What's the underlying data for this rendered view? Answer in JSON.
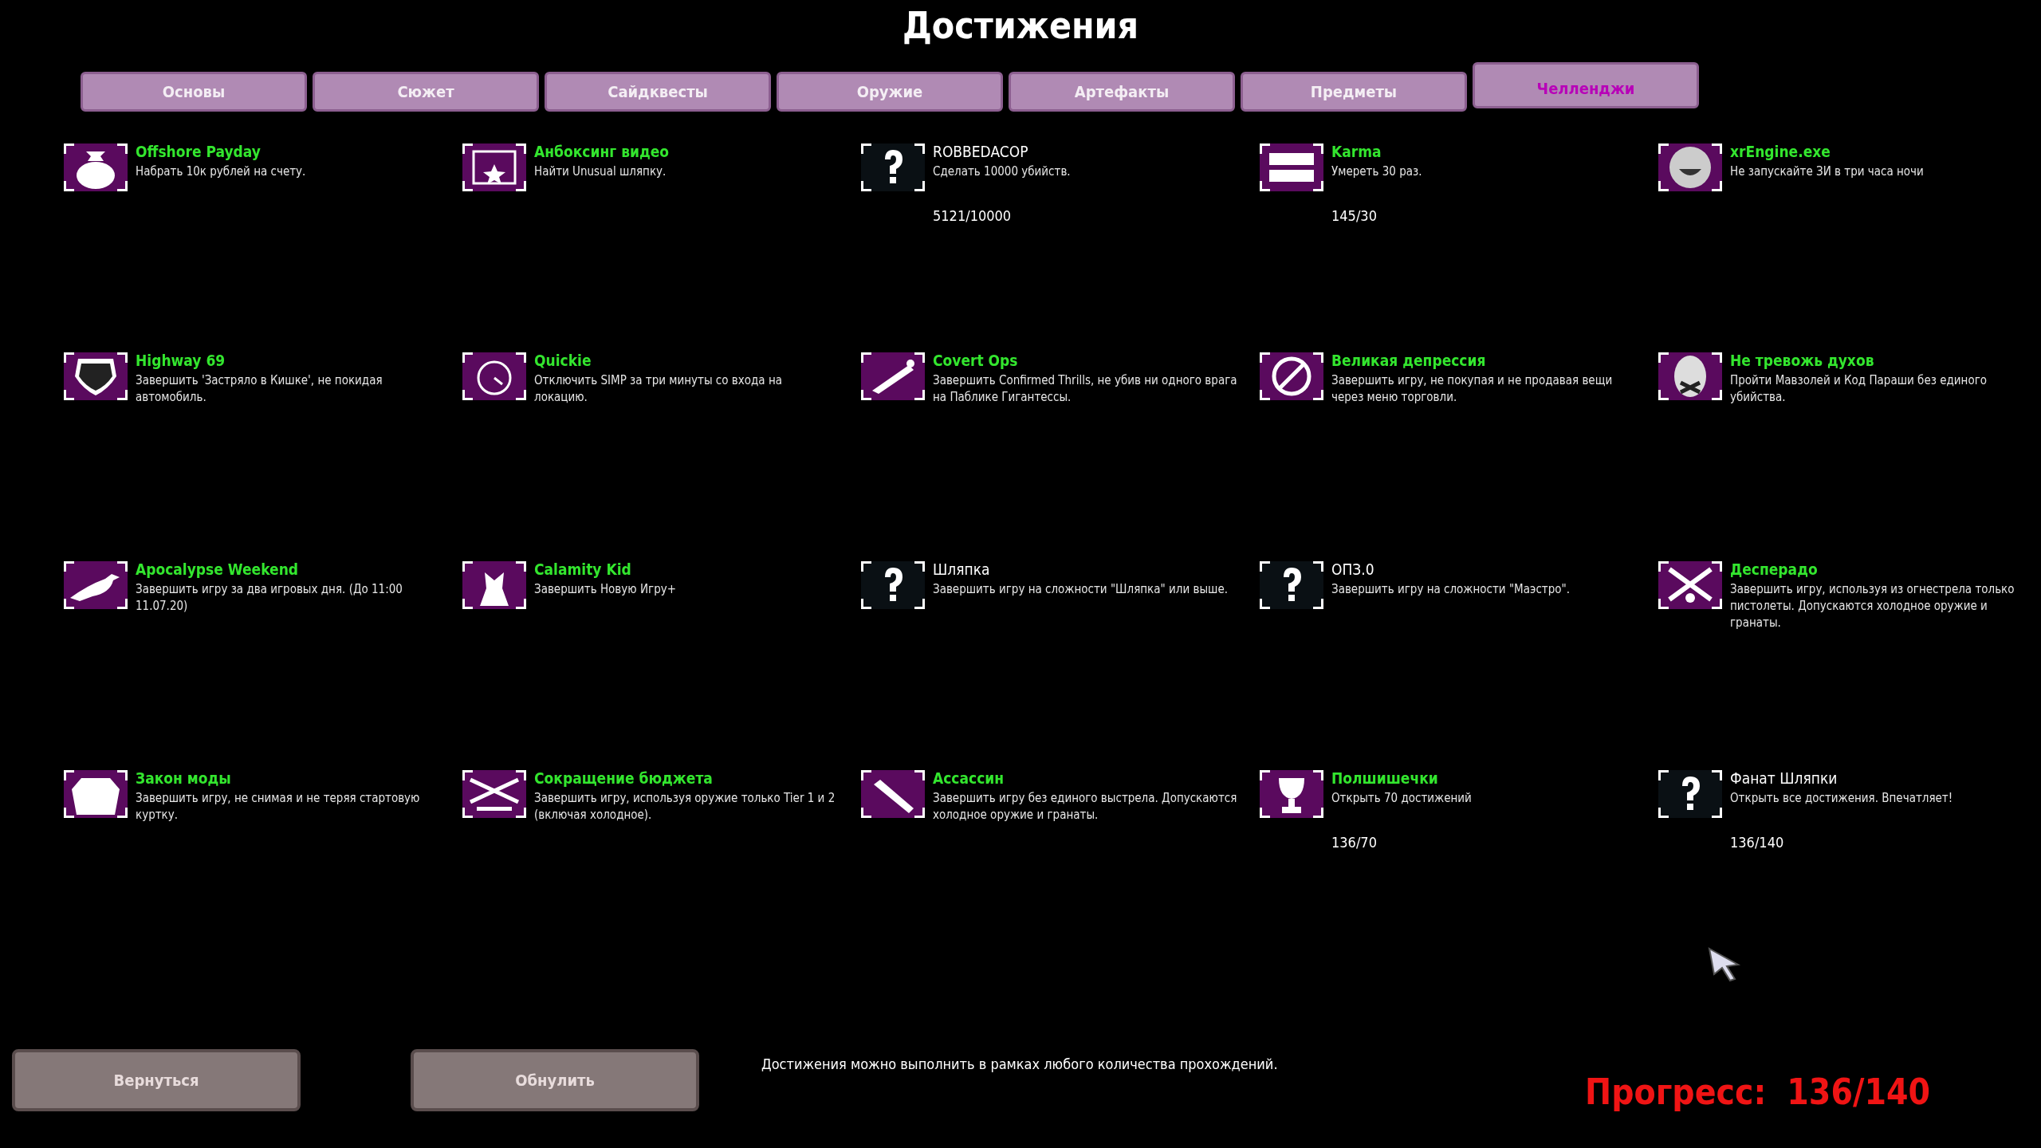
{
  "title": "Достижения",
  "tabs": [
    {
      "label": "Основы",
      "selected": false
    },
    {
      "label": "Сюжет",
      "selected": false
    },
    {
      "label": "Сайдквесты",
      "selected": false
    },
    {
      "label": "Оружие",
      "selected": false
    },
    {
      "label": "Артефакты",
      "selected": false
    },
    {
      "label": "Предметы",
      "selected": false
    },
    {
      "label": "Челленджи",
      "selected": true
    }
  ],
  "achievements": [
    {
      "title": "Offshore Payday",
      "description": "Набрать 10к рублей на счету.",
      "unlocked": true
    },
    {
      "title": "Анбоксинг видео",
      "description": "Найти Unusual шляпку.",
      "unlocked": true
    },
    {
      "title": "ROBBEDACOP",
      "description": "Сделать 10000 убийств.",
      "unlocked": false,
      "progress": "5121/10000"
    },
    {
      "title": "Karma",
      "description": "Умереть 30 раз.",
      "unlocked": true,
      "progress": "145/30"
    },
    {
      "title": "xrEngine.exe",
      "description": "Не запускайте ЗИ в три часа ночи",
      "unlocked": true
    },
    {
      "title": "Highway 69",
      "description": "Завершить 'Застряло в Кишке', не покидая автомобиль.",
      "unlocked": true
    },
    {
      "title": "Quickie",
      "description": "Отключить SIMP за три минуты со входа на локацию.",
      "unlocked": true
    },
    {
      "title": "Covert Ops",
      "description": "Завершить Confirmed Thrills, не убив ни одного врага на Паблике Гигантессы.",
      "unlocked": true
    },
    {
      "title": "Великая депрессия",
      "description": "Завершить игру, не покупая и не продавая вещи через меню торговли.",
      "unlocked": true
    },
    {
      "title": "Не тревожь духов",
      "description": "Пройти Мавзолей и Код Параши без единого убийства.",
      "unlocked": true
    },
    {
      "title": "Apocalypse Weekend",
      "description": "Завершить игру за два игровых дня. (До 11:00 11.07.20)",
      "unlocked": true
    },
    {
      "title": "Calamity Kid",
      "description": "Завершить Новую Игру+",
      "unlocked": true
    },
    {
      "title": "Шляпка",
      "description": "Завершить игру на сложности \"Шляпка\" или выше.",
      "unlocked": false
    },
    {
      "title": "ОПЗ.0",
      "description": "Завершить игру на сложности \"Маэстро\".",
      "unlocked": false
    },
    {
      "title": "Десперадо",
      "description": "Завершить игру, используя из огнестрела только пистолеты. Допускаются холодное оружие и гранаты.",
      "unlocked": true
    },
    {
      "title": "Закон моды",
      "description": "Завершить игру, не снимая и не теряя стартовую куртку.",
      "unlocked": true
    },
    {
      "title": "Сокращение бюджета",
      "description": "Завершить игру, используя оружие только Tier 1 и 2 (включая холодное).",
      "unlocked": true
    },
    {
      "title": "Ассассин",
      "description": "Завершить игру без единого выстрела. Допускаются холодное оружие и гранаты.",
      "unlocked": true
    },
    {
      "title": "Полшишечки",
      "description": "Открыть 70 достижений",
      "unlocked": true,
      "progress": "136/70"
    },
    {
      "title": "Фанат Шляпки",
      "description": "Открыть все достижения. Впечатляет!",
      "unlocked": false,
      "progress": "136/140"
    }
  ],
  "buttons": [
    "Вернуться",
    "Обнулить"
  ],
  "note": "Достижения можно выполнить в рамках любого количества прохождений.",
  "progress": {
    "label": "Прогресс:",
    "value": "136/140"
  }
}
